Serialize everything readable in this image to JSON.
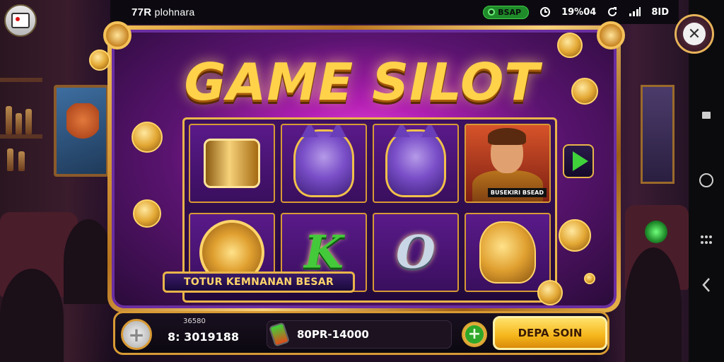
{
  "topbar": {
    "title": "77R",
    "title_suffix": " plohnara",
    "status_pill": "BSAP",
    "battery_text": "19%04",
    "signal_text": "8ID"
  },
  "game": {
    "logo": "GAME SILOT",
    "hero_tag": "BUSEKIRI BSEAD",
    "banner": "TOTUR KEMNANAN BESAR",
    "reel_symbols": [
      {
        "row": 0,
        "col": 0,
        "icon": "gold-coin-stack-icon"
      },
      {
        "row": 0,
        "col": 1,
        "icon": "purple-wolf-icon"
      },
      {
        "row": 0,
        "col": 2,
        "icon": "purple-wolf-icon"
      },
      {
        "row": 0,
        "col": 3,
        "icon": "warrior-hero-icon"
      },
      {
        "row": 1,
        "col": 0,
        "icon": "gold-coin-icon"
      },
      {
        "row": 1,
        "col": 1,
        "letter": "K"
      },
      {
        "row": 1,
        "col": 2,
        "letter": "O"
      },
      {
        "row": 1,
        "col": 3,
        "icon": "golden-dog-icon"
      }
    ]
  },
  "bottom": {
    "balance_label": "36580",
    "balance_value": "8: 3019188",
    "bet_value": "80PR-14000",
    "deposit_label": "DEPA SOIN"
  },
  "colors": {
    "gold": "#f4c25a",
    "purple": "#5a1470",
    "green": "#3fd23a",
    "deposit": "#f5b51a"
  }
}
